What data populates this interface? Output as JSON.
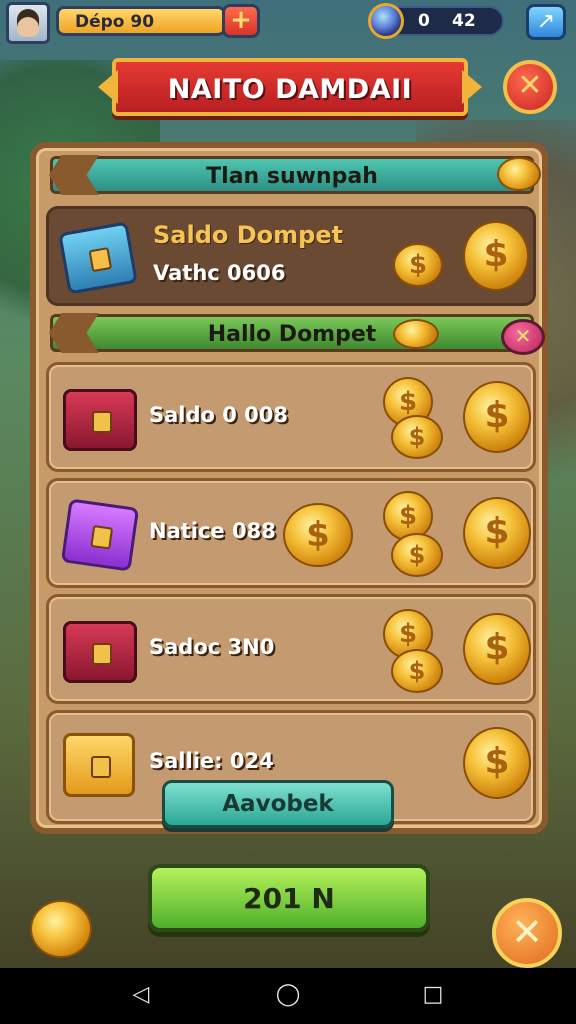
{
  "hud": {
    "gold_label": "Dépo 90",
    "add_symbol": "+",
    "gem_value_a": "0",
    "gem_value_b": "42",
    "share_icon": "share-icon"
  },
  "title_banner": {
    "text": "NAITO DAMDAII"
  },
  "panel": {
    "section1_title": "Tlan suwnpah",
    "main_card": {
      "title": "Saldo Dompet",
      "subtitle": "Vathc 0606"
    },
    "section2_title": "Hallo Dompet",
    "items": [
      {
        "label": "Saldo 0 008",
        "chest": "red-chest"
      },
      {
        "label": "Natice 088",
        "chest": "purple-chest"
      },
      {
        "label": "Sadoc 3N0",
        "chest": "red-chest"
      },
      {
        "label": "Sallie: 024",
        "chest": "gold-chest"
      }
    ],
    "approve_button": "Aavobek"
  },
  "bottom_button": "201 N",
  "colors": {
    "accent_red": "#e63a32",
    "panel_brown": "#c79a67",
    "button_green": "#4fb02b",
    "teal": "#2aa894",
    "coin_gold": "#f6c23a"
  }
}
